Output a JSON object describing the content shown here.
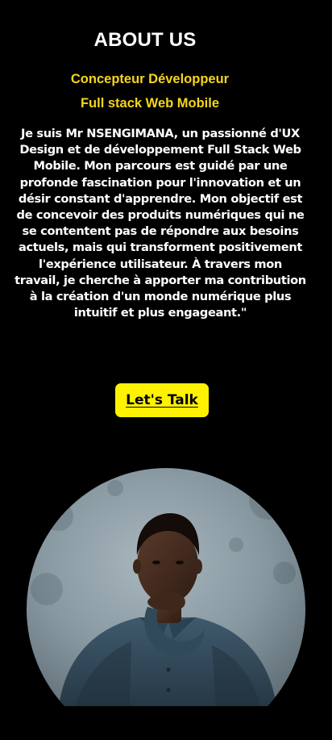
{
  "about": {
    "heading": "ABOUT US",
    "role_line1": "Concepteur Développeur",
    "role_line2": "Full stack Web Mobile",
    "bio": "Je suis Mr NSENGIMANA, un passionné d'UX Design et de développement Full Stack Web Mobile. Mon parcours est guidé par une profonde fascination pour l'innovation et un désir constant d'apprendre. Mon objectif est de concevoir des produits numériques qui ne se contentent pas de répondre aux besoins actuels, mais qui transforment positivement l'expérience utilisateur. À travers mon travail, je cherche à apporter ma contribution à la création d'un monde numérique plus intuitif et plus engageant.\"",
    "cta_label": "Let's Talk"
  },
  "colors": {
    "background": "#000000",
    "accent": "#f5d51d",
    "button": "#fff200",
    "text": "#ffffff"
  }
}
